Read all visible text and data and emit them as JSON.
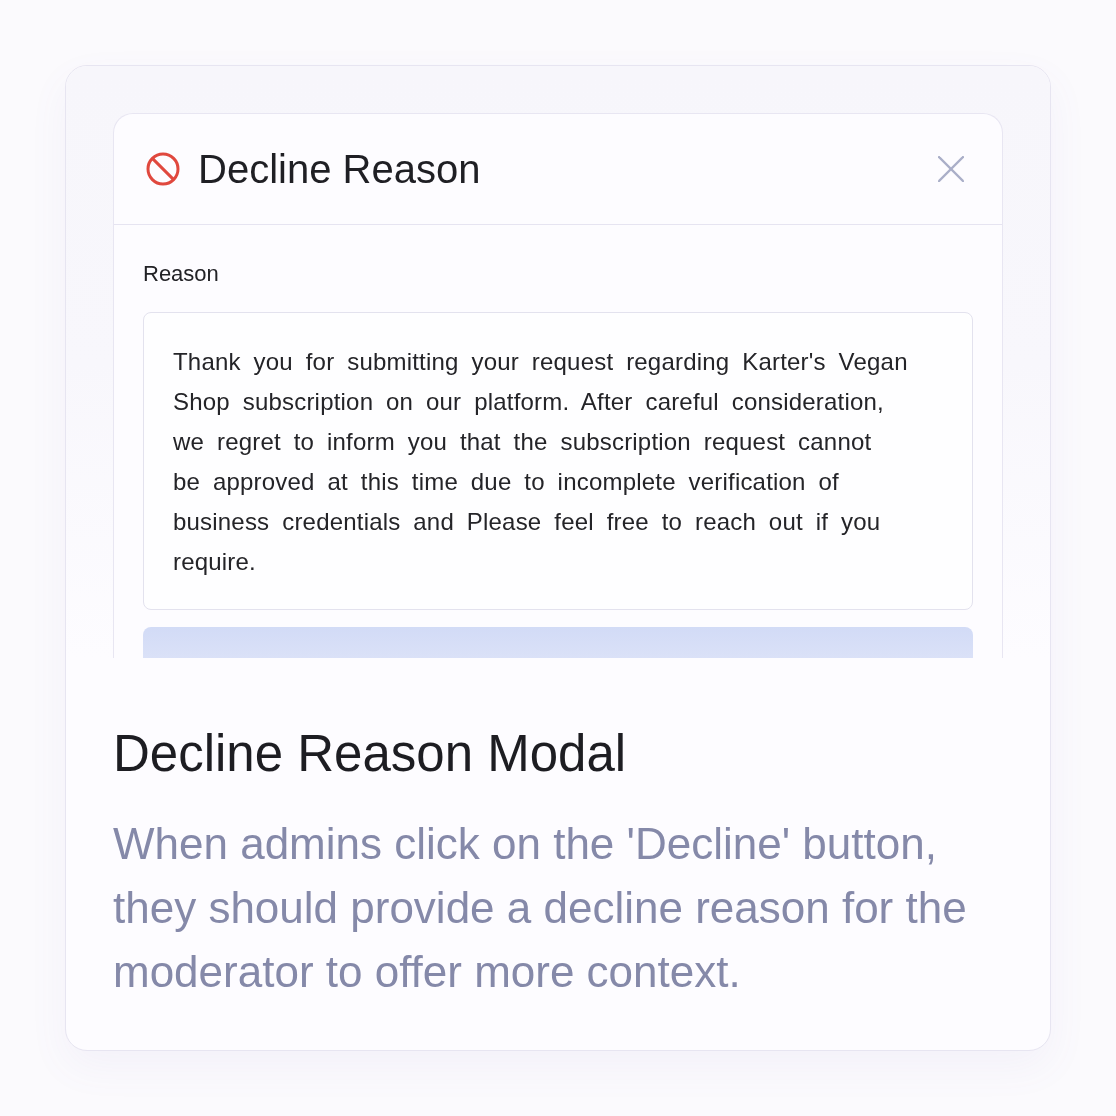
{
  "modal": {
    "title": "Decline Reason",
    "field": {
      "label": "Reason",
      "value": "Thank you for submitting your request regarding Karter's Vegan Shop subscription on our platform. After careful consideration, we regret to inform you that the subscription request cannot be approved at this time due to incomplete verification of business credentials and Please feel free to reach out if you require."
    }
  },
  "caption": {
    "title": "Decline Reason Modal",
    "description": "When admins click on the 'Decline' button, they should provide a decline reason for the moderator to offer more context."
  }
}
